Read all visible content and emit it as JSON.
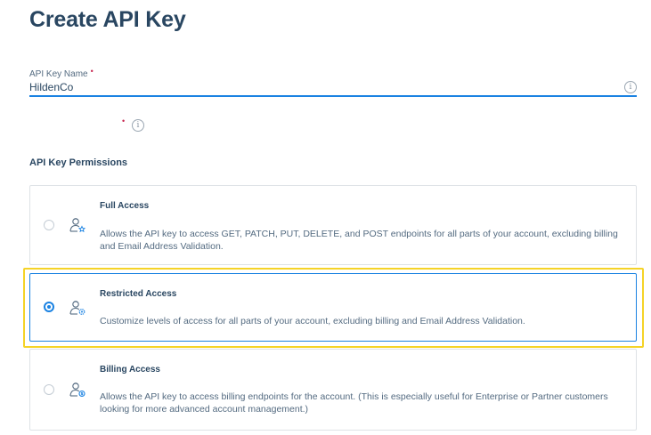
{
  "page": {
    "title": "Create API Key"
  },
  "api_key_name": {
    "label": "API Key Name",
    "required_marker": "•",
    "value": "HildenCo"
  },
  "second_field": {
    "required_marker": "•"
  },
  "permissions": {
    "heading": "API Key Permissions",
    "selected": "Restricted Access",
    "options": [
      {
        "title": "Full Access",
        "description": "Allows the API key to access GET, PATCH, PUT, DELETE, and POST endpoints for all parts of your account, excluding billing and Email Address Validation.",
        "icon": "user-star-icon",
        "checked": false
      },
      {
        "title": "Restricted Access",
        "description": "Customize levels of access for all parts of your account, excluding billing and Email Address Validation.",
        "icon": "user-gear-icon",
        "checked": true
      },
      {
        "title": "Billing Access",
        "description": "Allows the API key to access billing endpoints for the account. (This is especially useful for Enterprise or Partner customers looking for more advanced account management.)",
        "icon": "user-dollar-icon",
        "checked": false
      }
    ]
  },
  "icons": {
    "info": "i"
  },
  "colors": {
    "accent": "#1a82e2",
    "heading": "#294661",
    "required": "#c7254e",
    "highlight": "#f5d327"
  }
}
